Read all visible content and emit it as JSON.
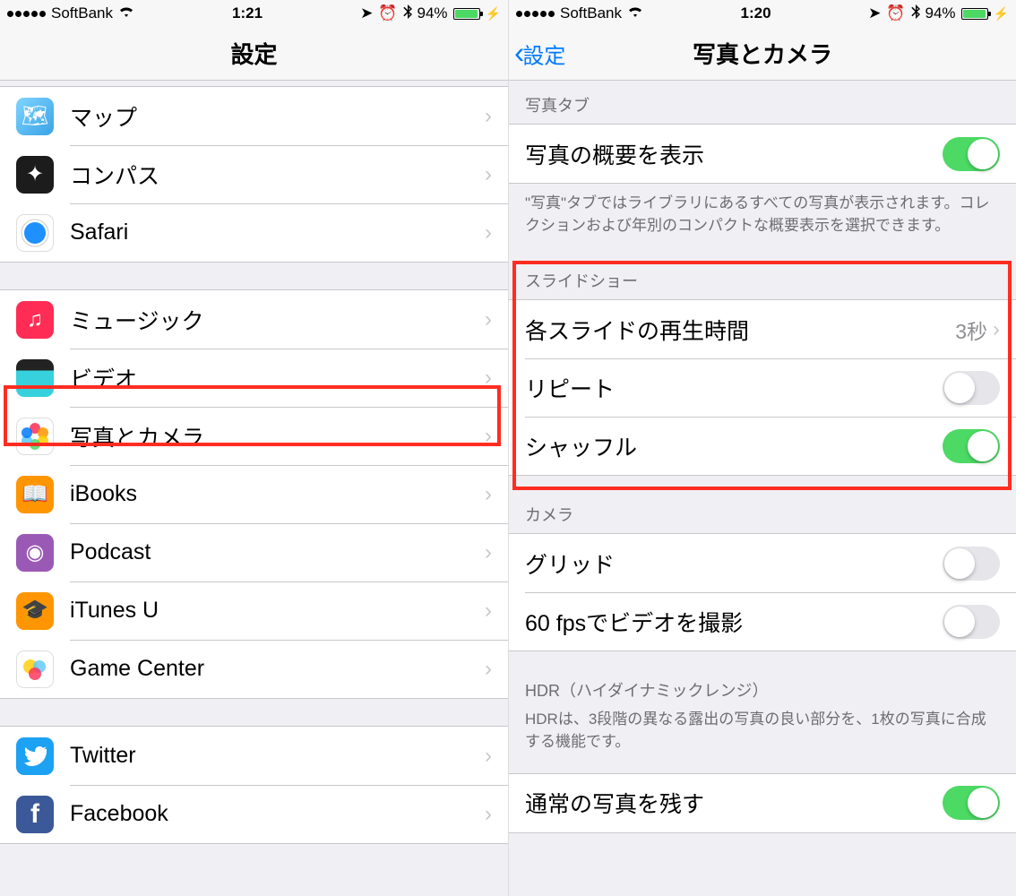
{
  "left": {
    "status": {
      "carrier": "SoftBank",
      "time": "1:21",
      "battery": "94%"
    },
    "nav": {
      "title": "設定"
    },
    "groups": [
      {
        "items": [
          {
            "icon": "maps-icon",
            "label": "マップ"
          },
          {
            "icon": "compass-icon",
            "label": "コンパス"
          },
          {
            "icon": "safari-icon",
            "label": "Safari"
          }
        ]
      },
      {
        "items": [
          {
            "icon": "music-icon",
            "label": "ミュージック"
          },
          {
            "icon": "video-icon",
            "label": "ビデオ"
          },
          {
            "icon": "photos-icon",
            "label": "写真とカメラ",
            "highlighted": true
          },
          {
            "icon": "ibooks-icon",
            "label": "iBooks"
          },
          {
            "icon": "podcast-icon",
            "label": "Podcast"
          },
          {
            "icon": "itunesu-icon",
            "label": "iTunes U"
          },
          {
            "icon": "gamecenter-icon",
            "label": "Game Center"
          }
        ]
      },
      {
        "items": [
          {
            "icon": "twitter-icon",
            "label": "Twitter"
          },
          {
            "icon": "facebook-icon",
            "label": "Facebook"
          }
        ]
      }
    ]
  },
  "right": {
    "status": {
      "carrier": "SoftBank",
      "time": "1:20",
      "battery": "94%"
    },
    "nav": {
      "back": "設定",
      "title": "写真とカメラ"
    },
    "section_photo_tab": {
      "header": "写真タブ",
      "summary_label": "写真の概要を表示",
      "summary_on": true,
      "footer": "\"写真\"タブではライブラリにあるすべての写真が表示されます。コレクションおよび年別のコンパクトな概要表示を選択できます。"
    },
    "section_slideshow": {
      "header": "スライドショー",
      "play_label": "各スライドの再生時間",
      "play_value": "3秒",
      "repeat_label": "リピート",
      "repeat_on": false,
      "shuffle_label": "シャッフル",
      "shuffle_on": true
    },
    "section_camera": {
      "header": "カメラ",
      "grid_label": "グリッド",
      "grid_on": false,
      "fps_label": "60 fpsでビデオを撮影",
      "fps_on": false
    },
    "section_hdr": {
      "header": "HDR（ハイダイナミックレンジ）",
      "footer": "HDRは、3段階の異なる露出の写真の良い部分を、1枚の写真に合成する機能です。",
      "keep_label": "通常の写真を残す",
      "keep_on": true
    }
  }
}
